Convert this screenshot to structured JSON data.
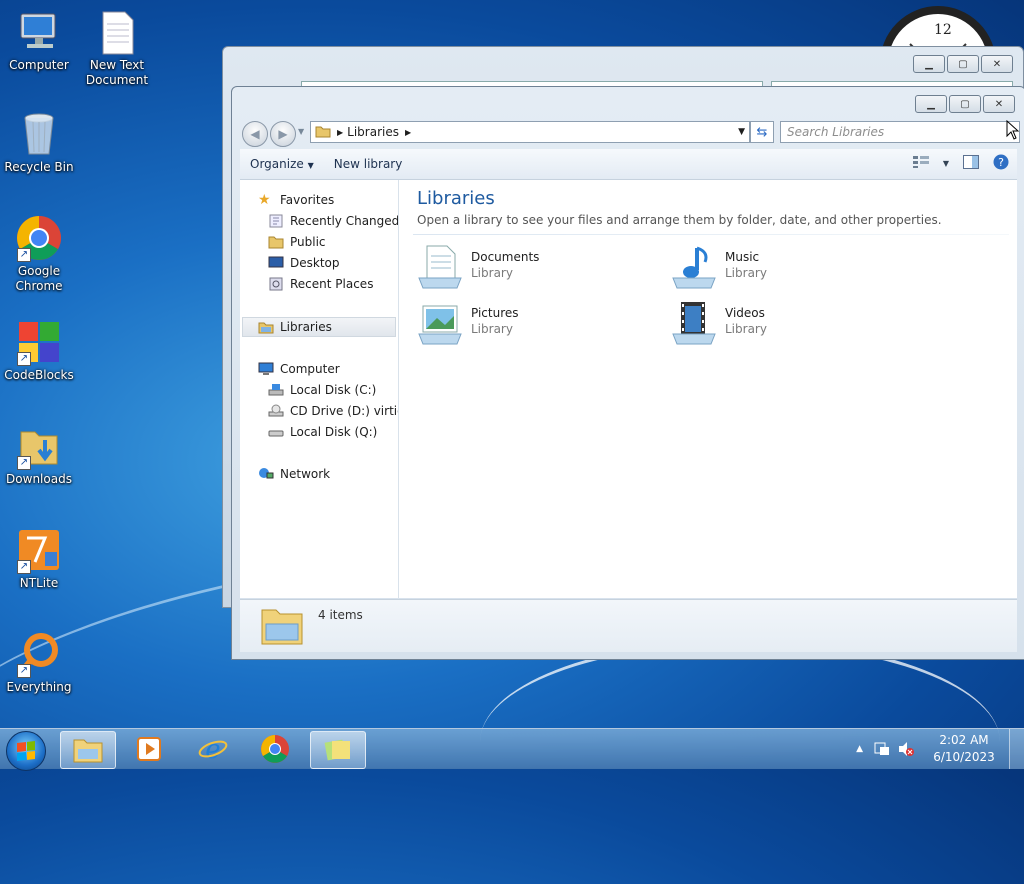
{
  "desktop": {
    "icons": [
      {
        "label": "Computer"
      },
      {
        "label": "New Text Document"
      },
      {
        "label": "Recycle Bin"
      },
      {
        "label": "Google Chrome"
      },
      {
        "label": "CodeBlocks"
      },
      {
        "label": "Downloads"
      },
      {
        "label": "NTLite"
      },
      {
        "label": "Everything"
      }
    ],
    "clock_numeral": "12"
  },
  "explorer": {
    "address": {
      "crumbs": [
        "Libraries"
      ]
    },
    "search": {
      "placeholder": "Search Libraries"
    },
    "toolbar": {
      "organize": "Organize",
      "new_library": "New library"
    },
    "nav": {
      "favorites": "Favorites",
      "favorites_items": [
        "Recently Changed",
        "Public",
        "Desktop",
        "Recent Places"
      ],
      "libraries": "Libraries",
      "computer": "Computer",
      "computer_items": [
        "Local Disk (C:)",
        "CD Drive (D:) virtio-win",
        "Local Disk (Q:)"
      ],
      "network": "Network"
    },
    "content": {
      "title": "Libraries",
      "subtitle": "Open a library to see your files and arrange them by folder, date, and other properties.",
      "libraries": [
        {
          "name": "Documents",
          "type": "Library",
          "icon": "documents-library-icon"
        },
        {
          "name": "Music",
          "type": "Library",
          "icon": "music-library-icon"
        },
        {
          "name": "Pictures",
          "type": "Library",
          "icon": "pictures-library-icon"
        },
        {
          "name": "Videos",
          "type": "Library",
          "icon": "videos-library-icon"
        }
      ]
    },
    "details": {
      "count": "4 items"
    }
  },
  "taskbar": {
    "pinned": [
      "windows-explorer-icon",
      "media-player-icon",
      "internet-explorer-icon",
      "chrome-icon",
      "sticky-notes-icon"
    ],
    "time": "2:02 AM",
    "date": "6/10/2023"
  },
  "colors": {
    "accent": "#1e5aa0",
    "taskbar": "#4f86bb"
  }
}
